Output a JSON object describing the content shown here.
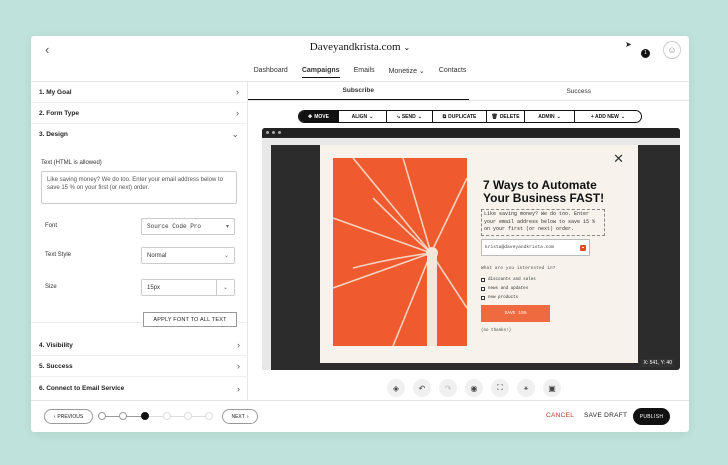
{
  "header": {
    "site_title": "Daveyandkrista.com",
    "notification_count": "1",
    "nav": [
      "Dashboard",
      "Campaigns",
      "Emails",
      "Monetize",
      "Contacts"
    ],
    "active_nav": "Campaigns"
  },
  "sidebar": {
    "sections": [
      {
        "label": "1. My Goal",
        "expanded": false
      },
      {
        "label": "2. Form Type",
        "expanded": false
      },
      {
        "label": "3. Design",
        "expanded": true
      },
      {
        "label": "4. Visibility",
        "expanded": false
      },
      {
        "label": "5. Success",
        "expanded": false
      },
      {
        "label": "6. Connect to Email Service",
        "expanded": false
      }
    ],
    "design": {
      "text_label": "Text (HTML is allowed)",
      "text_value": "Like saving money? We do too. Enter your email address below to save 15 % on your first (or next) order.",
      "font_label": "Font",
      "font_value": "Source Code Pro",
      "text_style_label": "Text Style",
      "text_style_value": "Normal",
      "size_label": "Size",
      "size_value": "15px",
      "apply_button": "APPLY FONT TO ALL TEXT"
    }
  },
  "main": {
    "subtabs": [
      "Subscribe",
      "Success"
    ],
    "toolbar": {
      "move": "MOVE",
      "align": "ALIGN",
      "send": "SEND",
      "duplicate": "DUPLICATE",
      "delete": "DELETE",
      "admin": "ADMIN",
      "add_new": "+ ADD NEW"
    },
    "popup": {
      "title": "7 Ways to Automate Your Business FAST!",
      "body": "Like saving money? We do too. Enter your email address below to save 15 % on your first (or next) order.",
      "email_value": "krista@daveyandkrista.com",
      "interest_label": "What are you interested in?",
      "options": [
        "discounts and sales",
        "news and updates",
        "new products"
      ],
      "save_button": "SAVE 15%",
      "no_thanks": "(no thanks!)",
      "coords": "X: 541, Y: 40"
    }
  },
  "footer": {
    "previous": "PREVIOUS",
    "next": "NEXT",
    "cancel": "CANCEL",
    "save_draft": "SAVE DRAFT",
    "publish": "PUBLISH"
  },
  "colors": {
    "accent_orange": "#ef6b3f",
    "cancel_red": "#c0392b",
    "background": "#bfe3dc"
  }
}
